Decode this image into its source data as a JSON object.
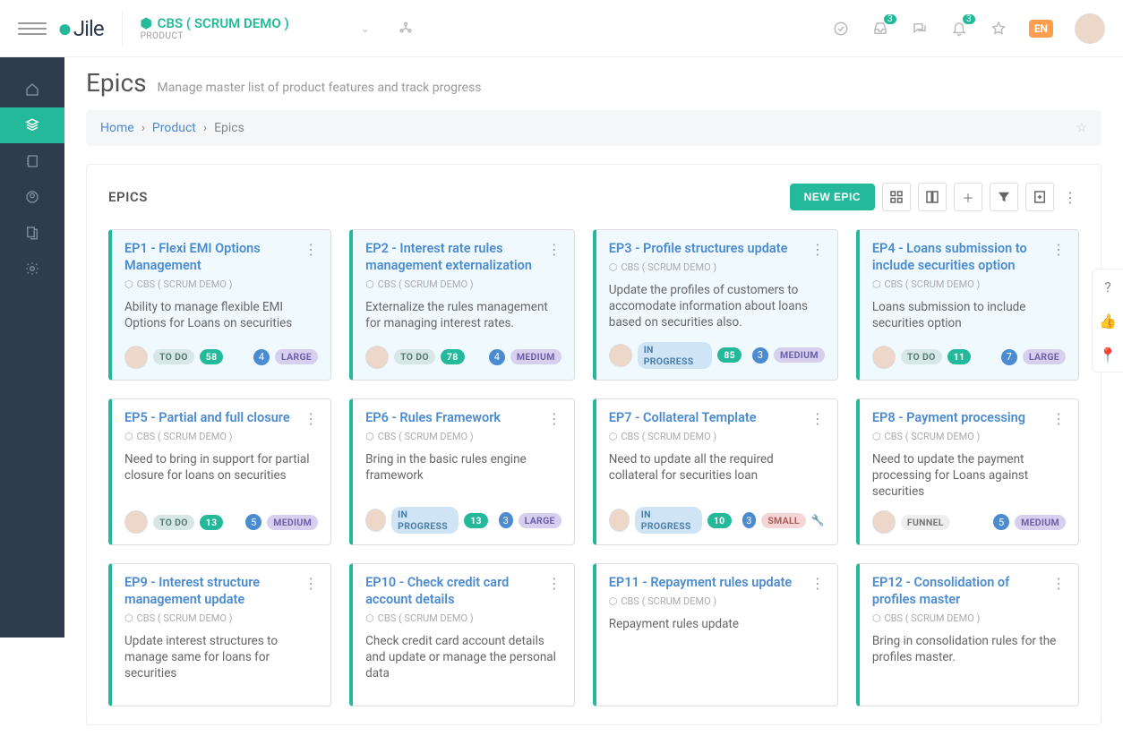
{
  "header": {
    "product_name": "CBS ( SCRUM DEMO )",
    "product_type": "PRODUCT",
    "lang": "EN",
    "inbox_badge": "3",
    "bell_badge": "3"
  },
  "page": {
    "title": "Epics",
    "subtitle": "Manage master list of product features and track progress"
  },
  "breadcrumb": {
    "home": "Home",
    "product": "Product",
    "current": "Epics"
  },
  "panel": {
    "title": "EPICS",
    "new_button": "NEW EPIC"
  },
  "cards": [
    {
      "title": "EP1 - Flexi EMI Options Management",
      "product": "CBS ( SCRUM DEMO )",
      "desc": "Ability to manage flexible EMI Options for Loans on securities",
      "status": "TO DO",
      "count": "58",
      "num": "4",
      "size": "LARGE",
      "highlight": true
    },
    {
      "title": "EP2 - Interest rate rules management externalization",
      "product": "CBS ( SCRUM DEMO )",
      "desc": "Externalize the rules management for managing interest rates.",
      "status": "TO DO",
      "count": "78",
      "num": "4",
      "size": "MEDIUM",
      "highlight": true
    },
    {
      "title": "EP3 - Profile structures update",
      "product": "CBS ( SCRUM DEMO )",
      "desc": "Update the profiles of customers to accomodate information about loans based on securities also.",
      "status": "IN PROGRESS",
      "count": "85",
      "num": "3",
      "size": "MEDIUM",
      "highlight": true
    },
    {
      "title": "EP4 - Loans submission to include securities option",
      "product": "CBS ( SCRUM DEMO )",
      "desc": "Loans submission to include securities option",
      "status": "TO DO",
      "count": "11",
      "num": "7",
      "size": "LARGE",
      "highlight": true
    },
    {
      "title": "EP5 - Partial and full closure",
      "product": "CBS ( SCRUM DEMO )",
      "desc": "Need to bring in support for partial closure for loans on securities",
      "status": "TO DO",
      "count": "13",
      "num": "5",
      "size": "MEDIUM",
      "highlight": false
    },
    {
      "title": "EP6 - Rules Framework",
      "product": "CBS ( SCRUM DEMO )",
      "desc": "Bring in the basic rules engine framework",
      "status": "IN PROGRESS",
      "count": "13",
      "num": "3",
      "size": "LARGE",
      "highlight": false
    },
    {
      "title": "EP7 - Collateral Template",
      "product": "CBS ( SCRUM DEMO )",
      "desc": "Need to update all the required collateral for securities loan",
      "status": "IN PROGRESS",
      "count": "10",
      "num": "3",
      "size": "SMALL",
      "highlight": false,
      "wrench": true
    },
    {
      "title": "EP8 - Payment processing",
      "product": "CBS ( SCRUM DEMO )",
      "desc": "Need to update the payment processing for Loans against securities",
      "status": "FUNNEL",
      "count": "",
      "num": "5",
      "size": "MEDIUM",
      "highlight": false
    },
    {
      "title": "EP9 - Interest structure management update",
      "product": "CBS ( SCRUM DEMO )",
      "desc": "Update interest structures to manage same for loans for securities",
      "status": "",
      "count": "",
      "num": "",
      "size": "",
      "highlight": false
    },
    {
      "title": "EP10 - Check credit card account details",
      "product": "CBS ( SCRUM DEMO )",
      "desc": "Check credit card account details and update or manage the personal data",
      "status": "",
      "count": "",
      "num": "",
      "size": "",
      "highlight": false
    },
    {
      "title": "EP11 - Repayment rules update",
      "product": "CBS ( SCRUM DEMO )",
      "desc": "Repayment rules update",
      "status": "",
      "count": "",
      "num": "",
      "size": "",
      "highlight": false
    },
    {
      "title": "EP12 - Consolidation of profiles master",
      "product": "CBS ( SCRUM DEMO )",
      "desc": "Bring in consolidation rules for the profiles master.",
      "status": "",
      "count": "",
      "num": "",
      "size": "",
      "highlight": false
    }
  ]
}
